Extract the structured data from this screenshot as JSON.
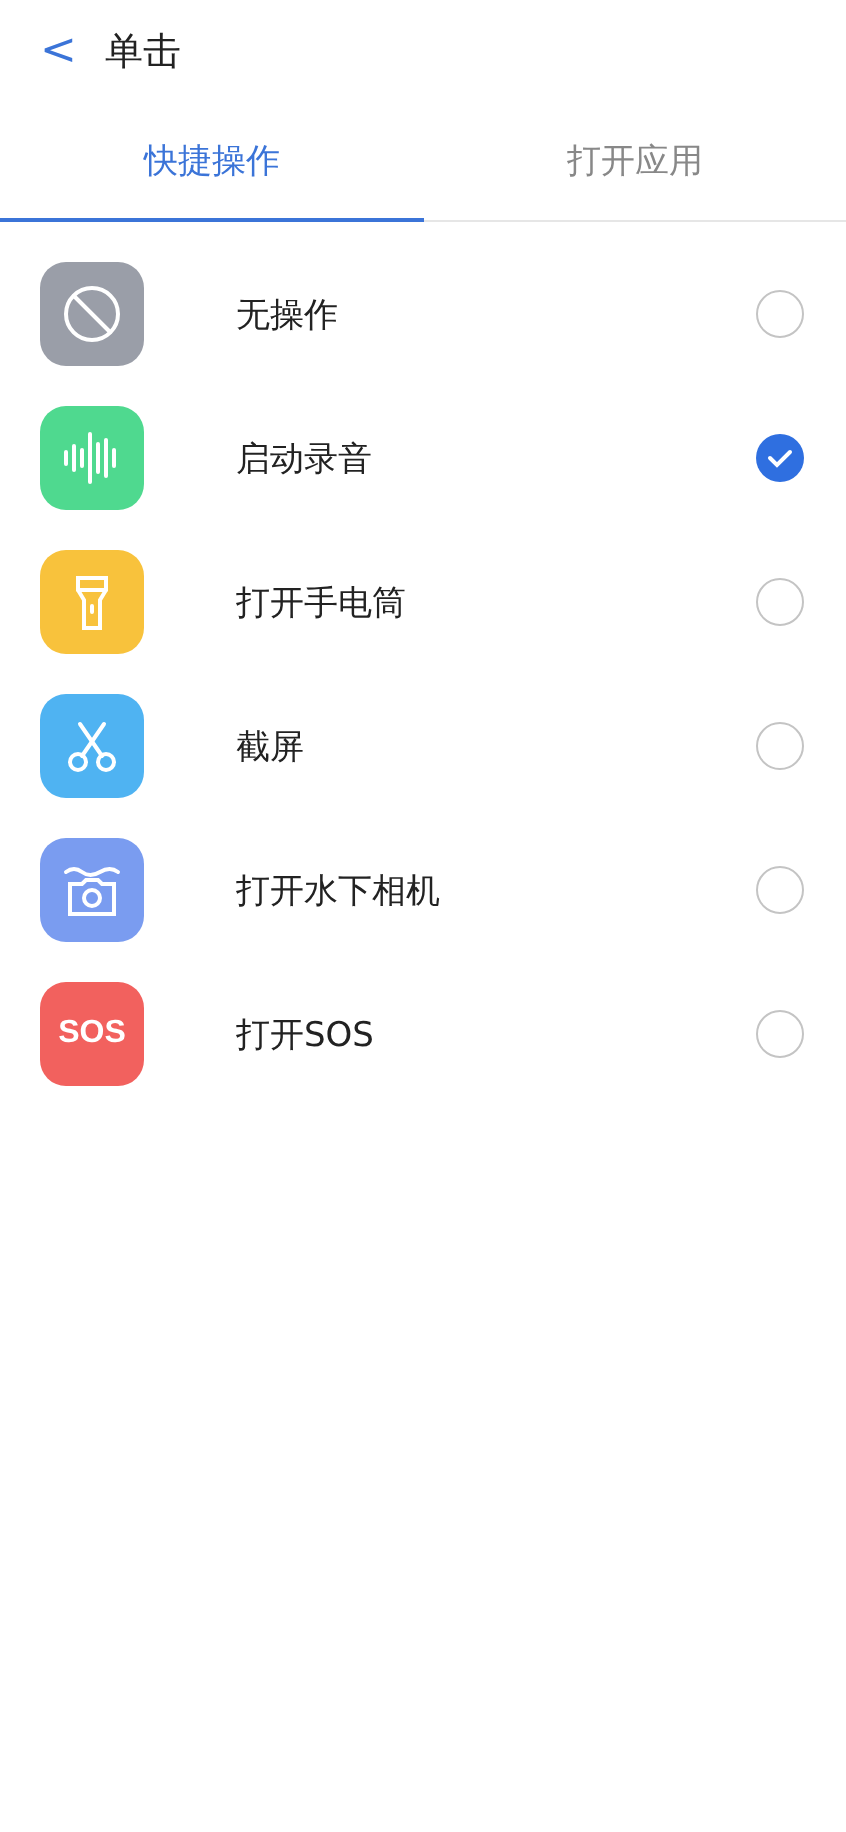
{
  "header": {
    "back": "<",
    "title": "单击"
  },
  "tabs": [
    {
      "label": "快捷操作",
      "selected": true
    },
    {
      "label": "打开应用",
      "selected": false
    }
  ],
  "options": [
    {
      "kind": "none",
      "label": "无操作",
      "color": "#9a9ea8",
      "selected": false
    },
    {
      "kind": "recorder",
      "label": "启动录音",
      "color": "#4fd98f",
      "selected": true
    },
    {
      "kind": "flashlight",
      "label": "打开手电筒",
      "color": "#f8c23c",
      "selected": false
    },
    {
      "kind": "screenshot",
      "label": "截屏",
      "color": "#4fb3f2",
      "selected": false
    },
    {
      "kind": "camera",
      "label": "打开水下相机",
      "color": "#7a9cf0",
      "selected": false
    },
    {
      "kind": "sos",
      "label": "打开SOS",
      "color": "#f2615e",
      "selected": false,
      "icon_text": "SOS"
    }
  ]
}
